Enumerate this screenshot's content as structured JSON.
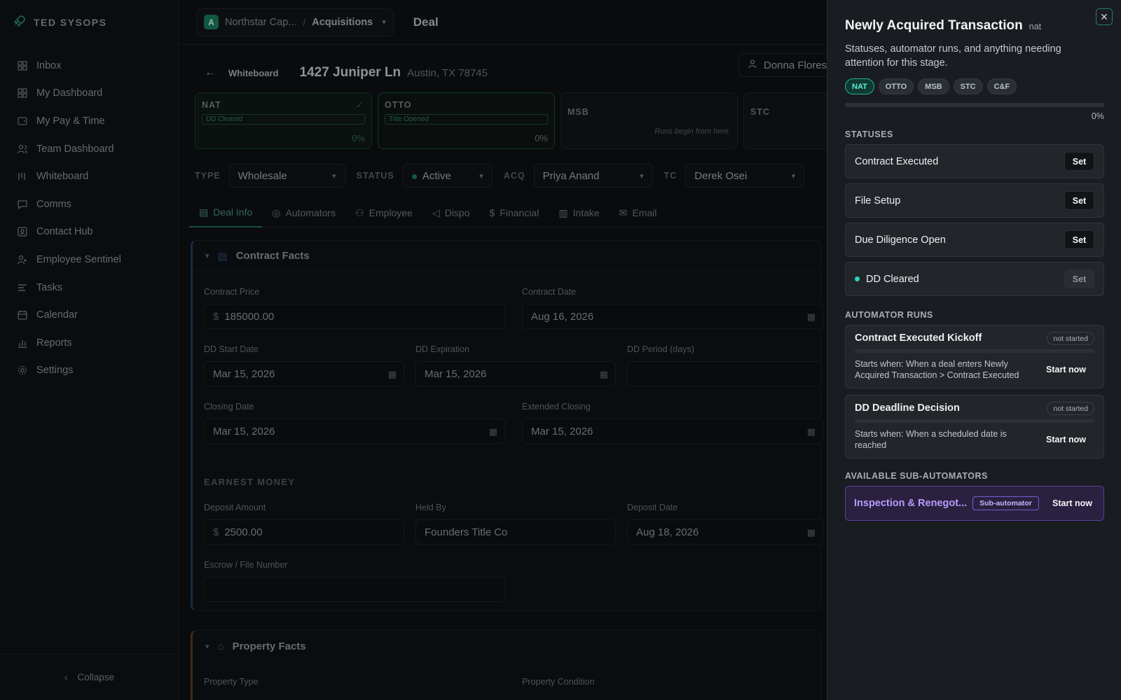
{
  "brand": {
    "name": "TED SYSOPS"
  },
  "sidebar": {
    "items": [
      {
        "label": "Inbox",
        "icon": "inbox-icon"
      },
      {
        "label": "My Dashboard",
        "icon": "dashboard-icon"
      },
      {
        "label": "My Pay & Time",
        "icon": "wallet-icon"
      },
      {
        "label": "Team Dashboard",
        "icon": "team-icon"
      },
      {
        "label": "Whiteboard",
        "icon": "whiteboard-icon"
      },
      {
        "label": "Comms",
        "icon": "chat-icon"
      },
      {
        "label": "Contact Hub",
        "icon": "contact-icon"
      },
      {
        "label": "Employee Sentinel",
        "icon": "user-shield-icon"
      },
      {
        "label": "Tasks",
        "icon": "tasks-icon"
      },
      {
        "label": "Calendar",
        "icon": "calendar-icon"
      },
      {
        "label": "Reports",
        "icon": "chart-icon"
      },
      {
        "label": "Settings",
        "icon": "gear-icon"
      }
    ],
    "collapse_label": "Collapse"
  },
  "topbar": {
    "org_initial": "A",
    "org_name": "Northstar Cap...",
    "separator": "/",
    "team": "Acquisitions",
    "page_title": "Deal"
  },
  "deal": {
    "breadcrumb": "Whiteboard",
    "address": "1427 Juniper Ln",
    "city": "Austin, TX 78745",
    "owner": "Donna Flores"
  },
  "stages": [
    {
      "name": "NAT",
      "chip": "DD Cleared",
      "pct": "0%",
      "state": "done"
    },
    {
      "name": "OTTO",
      "chip": "Title Opened",
      "pct": "0%",
      "state": "active"
    },
    {
      "name": "MSB",
      "note": "Runs begin from here",
      "state": "idle"
    },
    {
      "name": "STC",
      "state": "idle"
    }
  ],
  "meta": {
    "type_label": "TYPE",
    "type_value": "Wholesale",
    "status_label": "STATUS",
    "status_value": "Active",
    "acq_label": "ACQ",
    "acq_value": "Priya Anand",
    "tc_label": "TC",
    "tc_value": "Derek Osei"
  },
  "tabs": [
    "Deal Info",
    "Automators",
    "Employee",
    "Dispo",
    "Financial",
    "Intake",
    "Email"
  ],
  "contract": {
    "title": "Contract Facts",
    "price_label": "Contract Price",
    "currency": "$",
    "price": "185000.00",
    "date_label": "Contract Date",
    "date": "Aug 16, 2026",
    "dd_start_label": "DD Start Date",
    "dd_start": "Mar 15, 2026",
    "dd_exp_label": "DD Expiration",
    "dd_exp": "Mar 15, 2026",
    "dd_period_label": "DD Period (days)",
    "closing_label": "Closing Date",
    "closing": "Mar 15, 2026",
    "ext_label": "Extended Closing",
    "ext": "Mar 15, 2026",
    "earnest_heading": "EARNEST MONEY",
    "deposit_label": "Deposit Amount",
    "deposit": "2500.00",
    "held_label": "Held By",
    "held": "Founders Title Co",
    "deposit_date_label": "Deposit Date",
    "deposit_date": "Aug 18, 2026",
    "escrow_label": "Escrow / File Number"
  },
  "property": {
    "title": "Property Facts",
    "type_label": "Property Type",
    "condition_label": "Property Condition"
  },
  "drawer": {
    "title": "Newly Acquired Transaction",
    "tag": "nat",
    "subtitle": "Statuses, automator runs, and anything needing attention for this stage.",
    "pills": [
      "NAT",
      "OTTO",
      "MSB",
      "STC",
      "C&F"
    ],
    "progress": 0,
    "progress_label": "0%",
    "statuses_heading": "STATUSES",
    "statuses": [
      {
        "label": "Contract Executed",
        "button": "Set"
      },
      {
        "label": "File Setup",
        "button": "Set"
      },
      {
        "label": "Due Diligence Open",
        "button": "Set"
      },
      {
        "label": "DD Cleared",
        "button": "Set"
      }
    ],
    "runs_heading": "AUTOMATOR RUNS",
    "runs": [
      {
        "title": "Contract Executed Kickoff",
        "badge": "not started",
        "desc": "Starts when: When a deal enters Newly Acquired Transaction > Contract Executed",
        "button": "Start now"
      },
      {
        "title": "DD Deadline Decision",
        "badge": "not started",
        "desc": "Starts when: When a scheduled date is reached",
        "button": "Start now"
      }
    ],
    "sub_heading": "AVAILABLE SUB-AUTOMATORS",
    "sub": {
      "name": "Inspection & Renegot...",
      "tag": "Sub-automator",
      "button": "Start now"
    }
  },
  "colors": {
    "accent": "#2dd4bf",
    "sub_accent": "#b79cff"
  }
}
